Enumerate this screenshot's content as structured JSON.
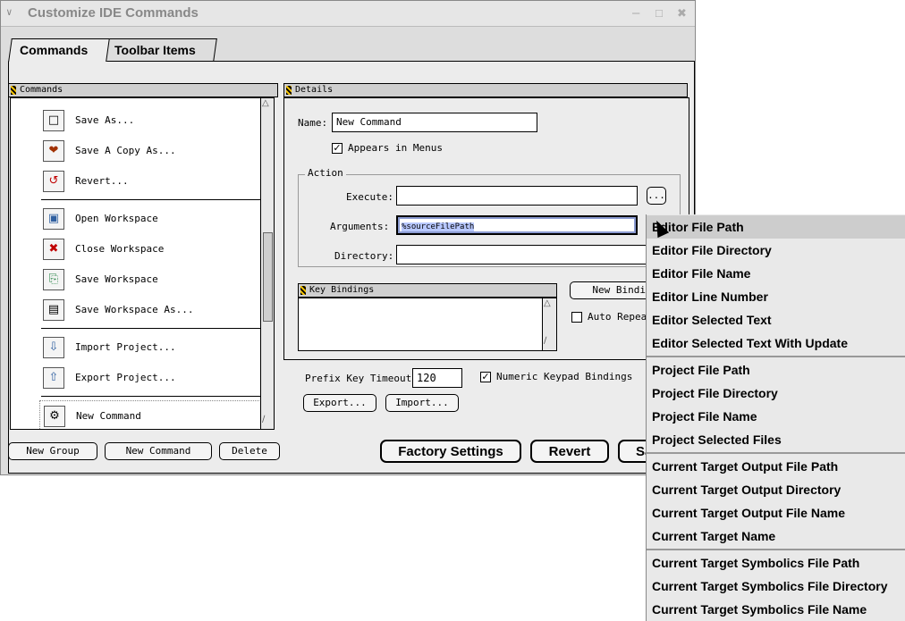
{
  "window": {
    "title": "Customize IDE Commands",
    "controls": {
      "collapse": "∨",
      "minimize": "‒",
      "zoom": "□",
      "close": "✖"
    }
  },
  "tabs": [
    {
      "label": "Commands"
    },
    {
      "label": "Toolbar Items"
    }
  ],
  "commands_panel": {
    "header": "Commands",
    "items": [
      {
        "label": "Save As...",
        "icon": "□"
      },
      {
        "label": "Save A Copy As...",
        "icon": "❤"
      },
      {
        "label": "Revert...",
        "icon": "↺"
      },
      {
        "label": "Open Workspace",
        "icon": "▣"
      },
      {
        "label": "Close Workspace",
        "icon": "✖"
      },
      {
        "label": "Save Workspace",
        "icon": "⎘"
      },
      {
        "label": "Save Workspace As...",
        "icon": "▤"
      },
      {
        "label": "Import Project...",
        "icon": "⇩"
      },
      {
        "label": "Export Project...",
        "icon": "⇧"
      },
      {
        "label": "New Command",
        "icon": "⚙"
      }
    ],
    "buttons": {
      "new_group": "New Group",
      "new_command": "New Command",
      "delete": "Delete"
    }
  },
  "details_panel": {
    "header": "Details",
    "name_label": "Name:",
    "name_value": "New Command",
    "appears_in_menus": {
      "label": "Appears in Menus",
      "checked": "✓"
    },
    "action": {
      "legend": "Action",
      "execute_label": "Execute:",
      "execute_value": "",
      "browse_button": "...",
      "arguments_label": "Arguments:",
      "arguments_value": "%sourceFilePath",
      "directory_label": "Directory:",
      "directory_value": ""
    },
    "key_bindings": {
      "header": "Key Bindings",
      "new_binding_button": "New Bindi",
      "auto_repeat_label": "Auto Repea"
    }
  },
  "bottom": {
    "prefix_key_timeout_label": "Prefix Key Timeout:",
    "prefix_key_timeout_value": "120",
    "numeric_keypad_label": "Numeric Keypad Bindings",
    "numeric_keypad_checked": "✓",
    "export_button": "Export...",
    "import_button": "Import...",
    "factory_settings_button": "Factory Settings",
    "revert_button": "Revert",
    "save_button": "Sa"
  },
  "context_menu": {
    "items": [
      "Editor File Path",
      "Editor File Directory",
      "Editor File Name",
      "Editor Line Number",
      "Editor Selected Text",
      "Editor Selected Text With Update",
      "Project File Path",
      "Project File Directory",
      "Project File Name",
      "Project Selected Files",
      "Current Target Output File Path",
      "Current Target Output Directory",
      "Current Target Output File Name",
      "Current Target Name",
      "Current Target Symbolics File Path",
      "Current Target Symbolics File Directory",
      "Current Target Symbolics File Name"
    ]
  },
  "colors": {
    "window_bg": "#dddddd",
    "selection": "#b8c8ff",
    "menu_bg": "#e9e9e9",
    "menu_highlight": "#cdcdcd"
  }
}
